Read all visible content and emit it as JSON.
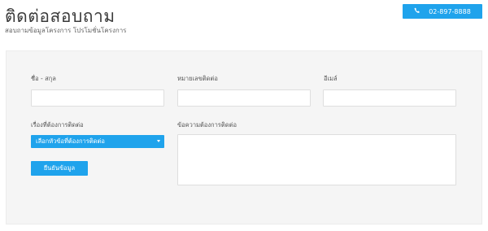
{
  "header": {
    "title": "ติดต่อสอบถาม",
    "subtitle": "สอบถามข้อมูลโครงการ โปรโมชั่นโครงการ",
    "phone": {
      "icon": "phone-icon",
      "label": "02-897-8888"
    }
  },
  "form": {
    "name_label": "ชื่อ - สกุล",
    "phone_label": "หมายเลขติดต่อ",
    "email_label": "อีเมล์",
    "topic_label": "เรื่องที่ต้องการติดต่อ",
    "topic_selected": "เลือกหัวข้อที่ต้องการติดต่อ",
    "message_label": "ข้อความต้องการติดต่อ",
    "submit_label": "ยืนยันข้อมูล"
  },
  "colors": {
    "accent": "#1fa3ec",
    "panel": "#f5f5f5"
  }
}
